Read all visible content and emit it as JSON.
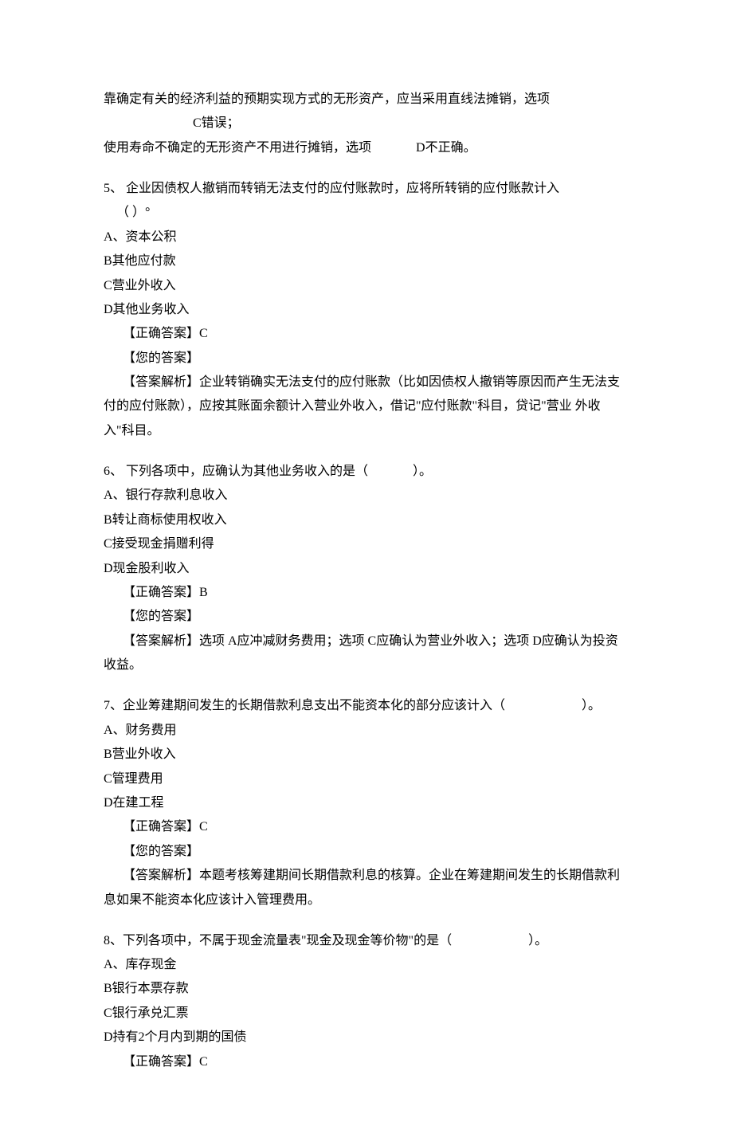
{
  "intro": {
    "line1_a": "靠确定有关的经济利益的预期实现方式的无形资产，应当采用直线法摊销，选项",
    "line1_b": "C错误；",
    "line2_a": "使用寿命不确定的无形资产不用进行摊销，选项",
    "line2_b": "D不正确。"
  },
  "q5": {
    "stem": "5、 企业因债权人撤销而转销无法支付的应付账款时，应将所转销的应付账款计入",
    "stem2": "（ ）°",
    "a": "A、资本公积",
    "b": "B其他应付款",
    "c": "C营业外收入",
    "d": "D其他业务收入",
    "correct": "【正确答案】C",
    "your": "【您的答案】",
    "ans1": "【答案解析】企业转销确实无法支付的应付账款（比如因债权人撤销等原因而产生无法支",
    "ans2": "付的应付账款），应按其账面余额计入营业外收入，借记\"应付账款\"科目，贷记\"营业 外收入\"科目。"
  },
  "q6": {
    "stem_a": "6、  下列各项中，应确认为其他业务收入的是（",
    "stem_b": "）。",
    "a": "A、银行存款利息收入",
    "b": "B转让商标使用权收入",
    "c": "C接受现金捐赠利得",
    "d": "D现金股利收入",
    "correct": "【正确答案】B",
    "your": "【您的答案】",
    "ans": "【答案解析】选项 A应冲减财务费用；选项 C应确认为营业外收入；选项 D应确认为投资 收益。"
  },
  "q7": {
    "stem_a": "7、企业筹建期间发生的长期借款利息支出不能资本化的部分应该计入（",
    "stem_b": "）。",
    "a": "A、财务费用",
    "b": "B营业外收入",
    "c": "C管理费用",
    "d": "D在建工程",
    "correct": "【正确答案】C",
    "your": "【您的答案】",
    "ans1": "【答案解析】本题考核筹建期间长期借款利息的核算。企业在筹建期间发生的长期借款利",
    "ans2": "息如果不能资本化应该计入管理费用。"
  },
  "q8": {
    "stem_a": "8、下列各项中，不属于现金流量表\"现金及现金等价物\"的是（",
    "stem_b": "）。",
    "a": "A、库存现金",
    "b": "B银行本票存款",
    "c": "C银行承兑汇票",
    "d": "D持有2个月内到期的国债",
    "correct": "【正确答案】C"
  }
}
